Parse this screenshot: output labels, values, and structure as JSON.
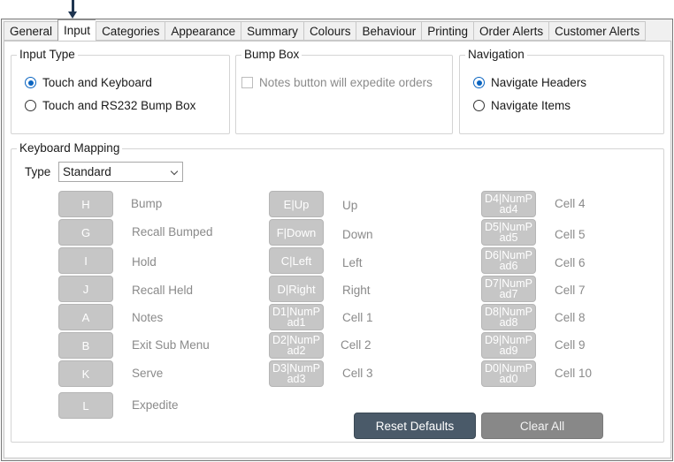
{
  "tabs": [
    "General",
    "Input",
    "Categories",
    "Appearance",
    "Summary",
    "Colours",
    "Behaviour",
    "Printing",
    "Order Alerts",
    "Customer Alerts"
  ],
  "input_type": {
    "title": "Input Type",
    "option1": "Touch and Keyboard",
    "option2": "Touch and RS232 Bump Box"
  },
  "bump_box": {
    "title": "Bump Box",
    "notes_option": "Notes button will expedite orders"
  },
  "navigation": {
    "title": "Navigation",
    "option1": "Navigate Headers",
    "option2": "Navigate Items"
  },
  "keyboard_mapping": {
    "title": "Keyboard Mapping",
    "type_label": "Type",
    "type_value": "Standard",
    "col1": [
      {
        "key": "H",
        "label": "Bump"
      },
      {
        "key": "G",
        "label": "Recall Bumped"
      },
      {
        "key": "I",
        "label": "Hold"
      },
      {
        "key": "J",
        "label": "Recall Held"
      },
      {
        "key": "A",
        "label": "Notes"
      },
      {
        "key": "B",
        "label": "Exit Sub Menu"
      },
      {
        "key": "K",
        "label": "Serve"
      },
      {
        "key": "L",
        "label": "Expedite"
      }
    ],
    "col2": [
      {
        "key": "E|Up",
        "label": "Up"
      },
      {
        "key": "F|Down",
        "label": "Down"
      },
      {
        "key": "C|Left",
        "label": "Left"
      },
      {
        "key": "D|Right",
        "label": "Right"
      },
      {
        "key": "D1|NumPad1",
        "label": "Cell 1"
      },
      {
        "key": "D2|NumPad2",
        "label": "Cell 2"
      },
      {
        "key": "D3|NumPad3",
        "label": "Cell 3"
      }
    ],
    "col3": [
      {
        "key": "D4|NumPad4",
        "label": "Cell 4"
      },
      {
        "key": "D5|NumPad5",
        "label": "Cell 5"
      },
      {
        "key": "D6|NumPad6",
        "label": "Cell 6"
      },
      {
        "key": "D7|NumPad7",
        "label": "Cell 7"
      },
      {
        "key": "D8|NumPad8",
        "label": "Cell 8"
      },
      {
        "key": "D9|NumPad9",
        "label": "Cell 9"
      },
      {
        "key": "D0|NumPad0",
        "label": "Cell 10"
      }
    ]
  },
  "actions": {
    "reset": "Reset Defaults",
    "clear": "Clear All"
  },
  "colors": {
    "accent": "#0a64c0",
    "action_dark": "#4a5a69",
    "action_grey": "#888888",
    "key_button": "#c6c6c6"
  }
}
